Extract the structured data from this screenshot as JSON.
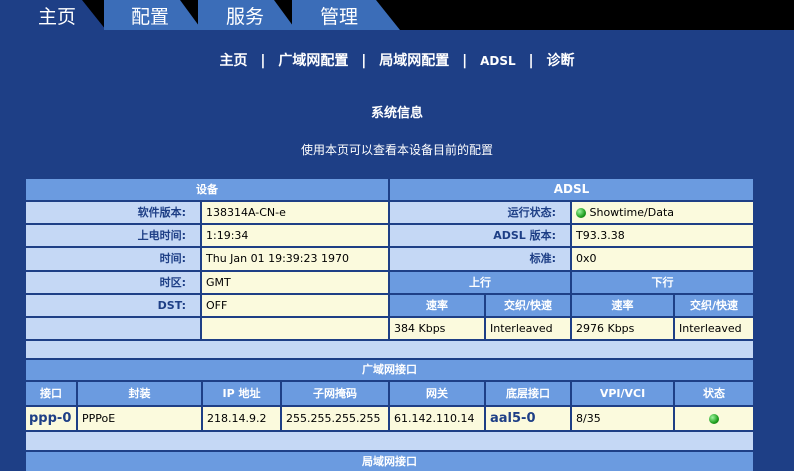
{
  "tabs": [
    "主页",
    "配置",
    "服务",
    "管理"
  ],
  "subnav": [
    "主页",
    "广域网配置",
    "局域网配置",
    "ADSL",
    "诊断"
  ],
  "separator": "|",
  "title": "系统信息",
  "description": "使用本页可以查看本设备目前的配置",
  "device": {
    "header": "设备",
    "rows": [
      {
        "label": "软件版本:",
        "value": "138314A-CN-e"
      },
      {
        "label": "上电时间:",
        "value": "1:19:34"
      },
      {
        "label": "时间:",
        "value": "Thu Jan 01 19:39:23 1970"
      },
      {
        "label": "时区:",
        "value": "GMT"
      },
      {
        "label": "DST:",
        "value": "OFF"
      }
    ]
  },
  "adsl": {
    "header": "ADSL",
    "rows": [
      {
        "label": "运行状态:",
        "value": "Showtime/Data"
      },
      {
        "label": "ADSL 版本:",
        "value": "T93.3.38"
      },
      {
        "label": "标准:",
        "value": "0x0"
      }
    ],
    "upstream": "上行",
    "downstream": "下行",
    "rate": "速率",
    "mode": "交织/快速",
    "up_rate": "384 Kbps",
    "up_mode": "Interleaved",
    "down_rate": "2976 Kbps",
    "down_mode": "Interleaved"
  },
  "wan": {
    "header": "广域网接口",
    "columns": [
      "接口",
      "封装",
      "IP 地址",
      "子网掩码",
      "网关",
      "底层接口",
      "VPI/VCI",
      "状态"
    ],
    "row": {
      "interface": "ppp-0",
      "encap": "PPPoE",
      "ip": "218.14.9.2",
      "mask": "255.255.255.255",
      "gateway": "61.142.110.14",
      "lower": "aal5-0",
      "vpivci": "8/35",
      "status_icon": "green-status-dot"
    }
  },
  "lan": {
    "header": "局域网接口"
  }
}
